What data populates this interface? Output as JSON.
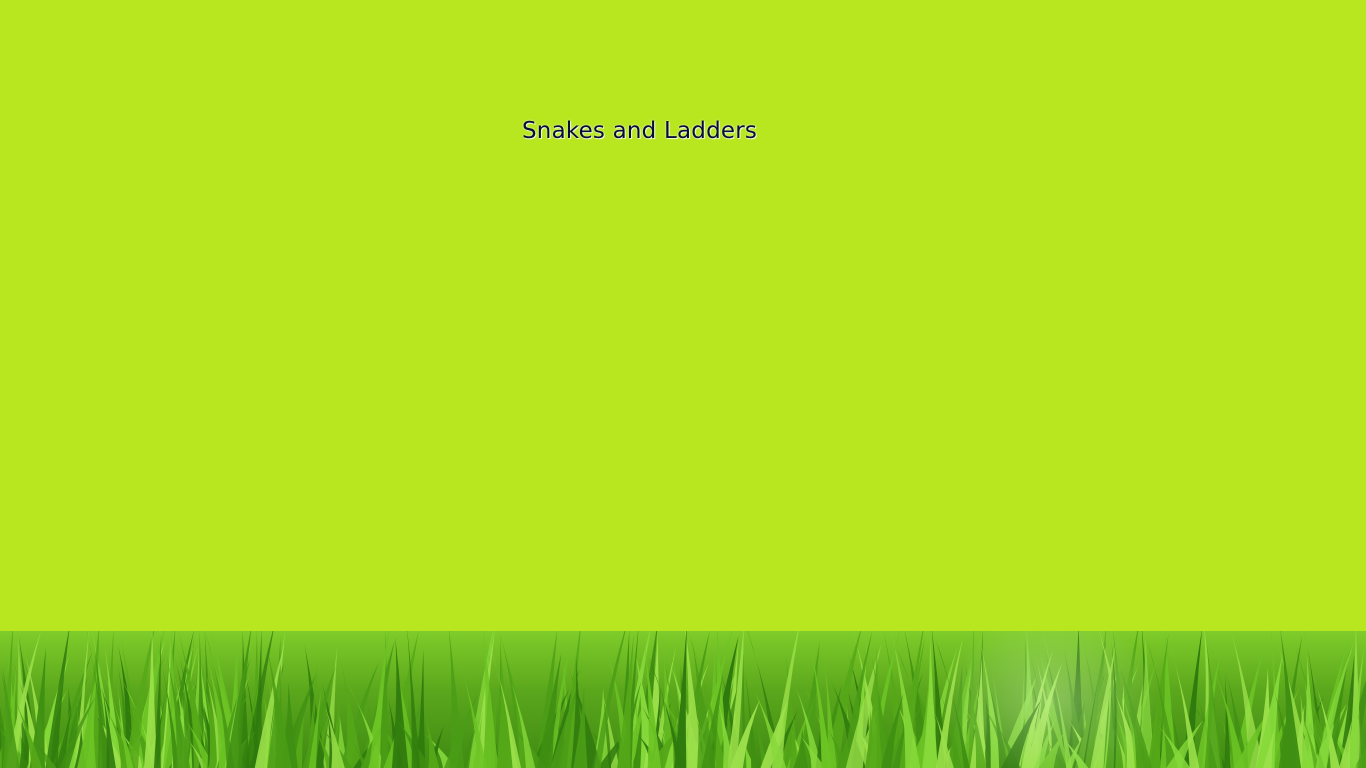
{
  "game": {
    "title": "Snakes and Ladders"
  },
  "scene": {
    "background_color": "#b8e61f",
    "ground": "grass"
  }
}
